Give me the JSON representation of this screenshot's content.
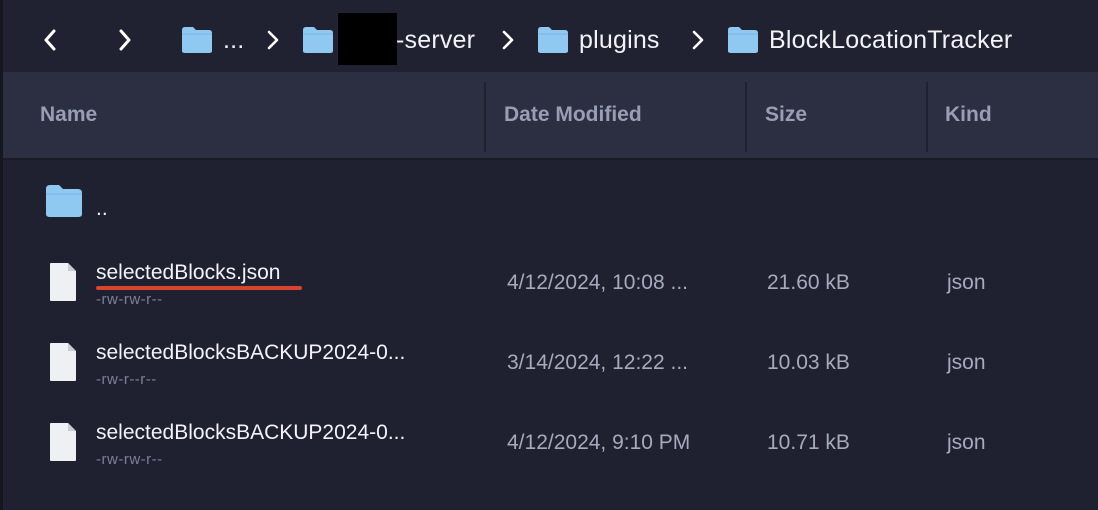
{
  "accent_underline_color": "#d8452f",
  "folder_color": "#8fc9f2",
  "toolbar": {
    "back_icon": "chevron-left-icon",
    "forward_icon": "chevron-right-icon",
    "breadcrumb": [
      {
        "label": "...",
        "icon": "folder-icon"
      },
      {
        "label": "-server",
        "icon": "folder-icon",
        "redacted_prefix": true
      },
      {
        "label": "plugins",
        "icon": "folder-icon"
      },
      {
        "label": "BlockLocationTracker",
        "icon": "folder-icon"
      }
    ]
  },
  "columns": {
    "name": "Name",
    "date_modified": "Date Modified",
    "size": "Size",
    "kind": "Kind"
  },
  "rows": [
    {
      "name": "..",
      "type": "parent-folder",
      "icon": "folder-icon"
    },
    {
      "name": "selectedBlocks.json",
      "permissions": "-rw-rw-r--",
      "date_modified": "4/12/2024, 10:08 ...",
      "size": "21.60 kB",
      "kind": "json",
      "icon": "file-icon",
      "underlined": true
    },
    {
      "name": "selectedBlocksBACKUP2024-0...",
      "permissions": "-rw-r--r--",
      "date_modified": "3/14/2024, 12:22 ...",
      "size": "10.03 kB",
      "kind": "json",
      "icon": "file-icon"
    },
    {
      "name": "selectedBlocksBACKUP2024-0...",
      "permissions": "-rw-rw-r--",
      "date_modified": "4/12/2024, 9:10 PM",
      "size": "10.71 kB",
      "kind": "json",
      "icon": "file-icon"
    }
  ]
}
